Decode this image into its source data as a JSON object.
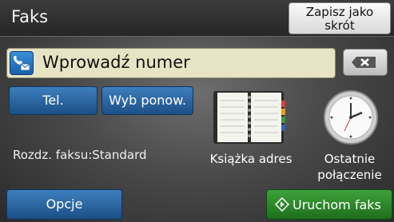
{
  "header": {
    "title": "Faks",
    "shortcut_label": "Zapisz jako skrót"
  },
  "number_field": {
    "placeholder": "Wprowadź numer",
    "icon": "fax-phone-icon"
  },
  "backspace": {
    "icon": "backspace-icon"
  },
  "buttons": {
    "tel": "Tel.",
    "redial": "Wyb ponow.",
    "options": "Opcje",
    "start_fax": "Uruchom faks"
  },
  "resolution_text": "Rozdz. faksu:Standard",
  "address_book": {
    "label": "Książka adres",
    "icon": "address-book-icon"
  },
  "recent_calls": {
    "label": "Ostatnie połączenie",
    "icon": "clock-icon"
  },
  "colors": {
    "header": "#2e2e2e",
    "field": "#e6e4c4",
    "blue_button": "#2a64a0",
    "green_button": "#2f8a2b"
  }
}
